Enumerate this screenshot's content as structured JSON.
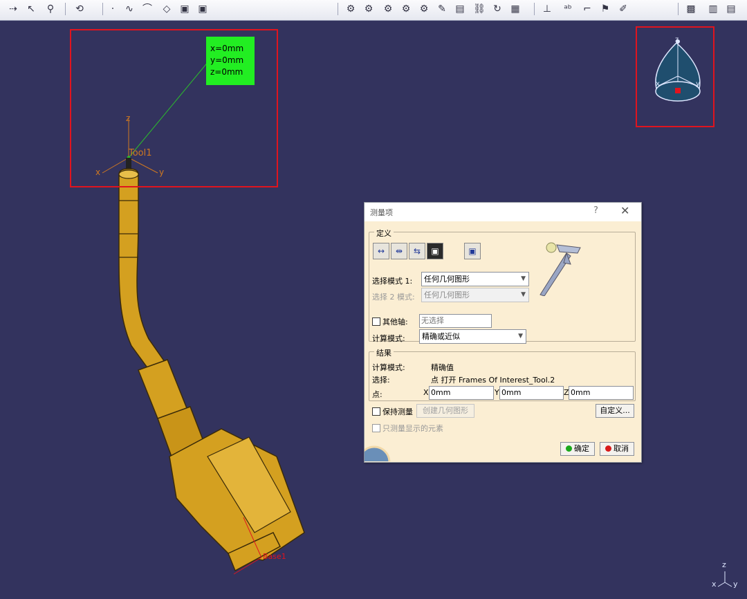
{
  "colors": {
    "viewport_bg": "#33335e",
    "highlight_box": "#e0141e",
    "coord_box": "#22ee22",
    "dialog_bg": "#fbeed3",
    "tool_color": "#d4a020"
  },
  "toolbar": {
    "icons": [
      "arrow-dots-icon",
      "select-cursor-icon",
      "magnet-icon",
      "rotate-tool-icon",
      "point-icon",
      "curve-icon",
      "arc-icon",
      "surface-icon",
      "cube-icon",
      "cube2-icon",
      "measure1-icon",
      "measure2-icon",
      "measure3-icon",
      "measure4-icon",
      "measure5-icon",
      "pencil-icon",
      "frame-icon",
      "link-icon",
      "refresh-icon",
      "grid-icon",
      "axis-icon",
      "abc-icon",
      "annotation-icon",
      "flag-icon",
      "paint-icon",
      "box-view-icon",
      "library-icon",
      "catalog-icon"
    ]
  },
  "scene": {
    "coord_box": {
      "x": "x=0mm",
      "y": "y=0mm",
      "z": "z=0mm"
    },
    "tool_label": "Tool1",
    "axes": {
      "x": "x",
      "y": "y",
      "z": "z"
    },
    "base_label": "Base1"
  },
  "dialog": {
    "title": "测量项",
    "help": "?",
    "close": "✕",
    "definition_group": "定义",
    "select_mode_1_label": "选择模式 1:",
    "select_mode_1_value": "任何几何图形",
    "select_mode_2_label": "选择 2 模式:",
    "select_mode_2_value": "任何几何图形",
    "other_axis_label": "其他轴:",
    "other_axis_value": "无选择",
    "calc_mode_label": "计算模式:",
    "calc_mode_value": "精确或近似",
    "results_group": "结果",
    "result_calc_mode_label": "计算模式:",
    "result_calc_mode_value": "精确值",
    "result_selection_label": "选择:",
    "result_selection_value": "点 打开 Frames Of Interest_Tool.2",
    "point_label": "点:",
    "x_label": "X",
    "x_value": "0mm",
    "y_label": "Y",
    "y_value": "0mm",
    "z_label": "Z",
    "z_value": "0mm",
    "keep_measure_label": "保持测量",
    "create_geometry_label": "创建几何图形",
    "customize_label": "自定义...",
    "visible_only_label": "只测量显示的元素",
    "ok_label": "确定",
    "cancel_label": "取消"
  }
}
